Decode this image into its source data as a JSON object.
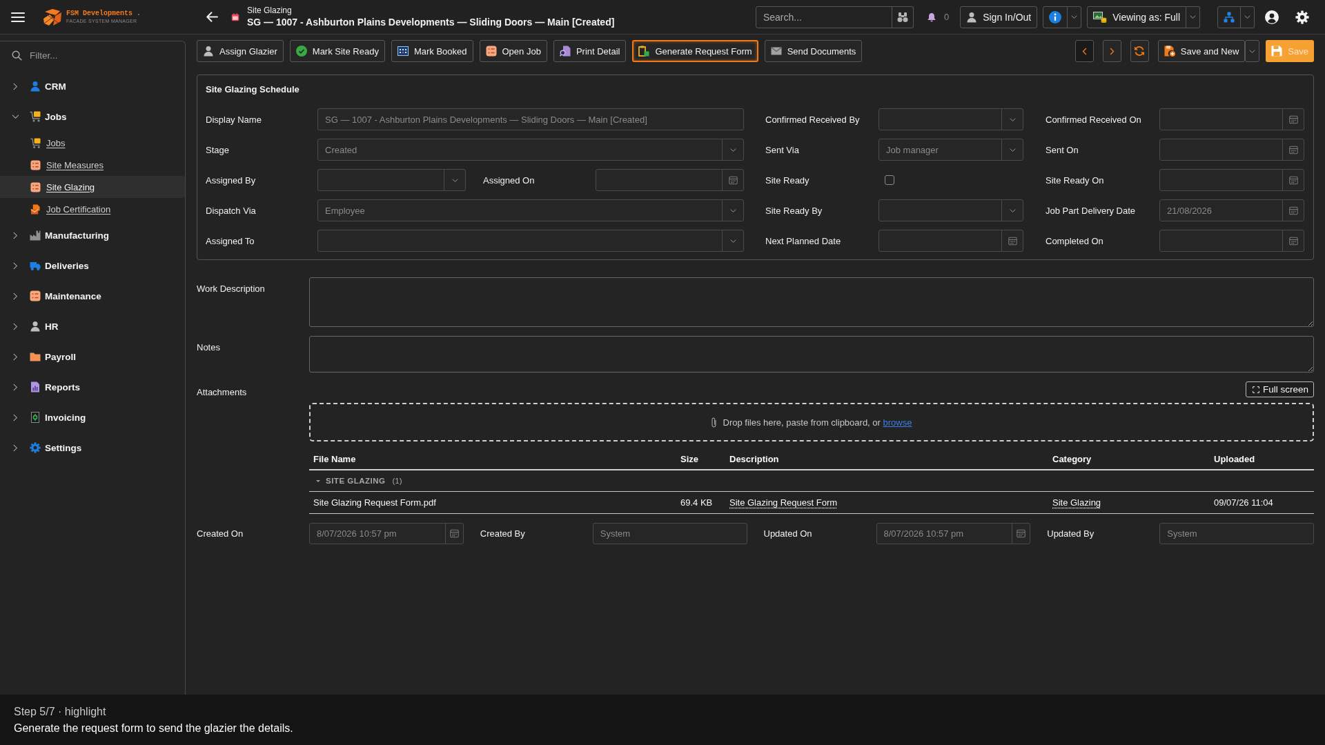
{
  "topbar": {
    "logo": {
      "name": "FSM Developments .",
      "tagline": "FACADE SYSTEM MANAGER"
    },
    "breadcrumb": "Site Glazing",
    "title": "SG — 1007 - Ashburton Plains Developments — Sliding Doors — Main [Created]",
    "search": {
      "placeholder": "Search..."
    },
    "notification_count": "0",
    "sign_button": "Sign In/Out",
    "viewing_button": "Viewing as: Full"
  },
  "sidebar": {
    "filter": {
      "placeholder": "Filter..."
    },
    "items": [
      {
        "label": "CRM",
        "expanded": false
      },
      {
        "label": "Jobs",
        "expanded": true,
        "children": [
          {
            "label": "Jobs",
            "selected": false
          },
          {
            "label": "Site Measures",
            "selected": false
          },
          {
            "label": "Site Glazing",
            "selected": true
          },
          {
            "label": "Job Certification",
            "selected": false
          }
        ]
      },
      {
        "label": "Manufacturing",
        "expanded": false
      },
      {
        "label": "Deliveries",
        "expanded": false
      },
      {
        "label": "Maintenance",
        "expanded": false
      },
      {
        "label": "HR",
        "expanded": false
      },
      {
        "label": "Payroll",
        "expanded": false
      },
      {
        "label": "Reports",
        "expanded": false
      },
      {
        "label": "Invoicing",
        "expanded": false
      },
      {
        "label": "Settings",
        "expanded": false
      }
    ]
  },
  "toolbar": {
    "buttons": [
      {
        "label": "Assign Glazier",
        "highlighted": false
      },
      {
        "label": "Mark Site Ready",
        "highlighted": false
      },
      {
        "label": "Mark Booked",
        "highlighted": false
      },
      {
        "label": "Open Job",
        "highlighted": false
      },
      {
        "label": "Print Detail",
        "highlighted": false
      },
      {
        "label": "Generate Request Form",
        "highlighted": true
      },
      {
        "label": "Send Documents",
        "highlighted": false
      }
    ],
    "save_buttons": [
      {
        "label": "Save and New",
        "kind": "split"
      },
      {
        "label": "Save",
        "kind": "primary"
      }
    ]
  },
  "schedule": {
    "title": "Site Glazing Schedule",
    "rows": [
      {
        "fields": [
          {
            "label": "Display Name",
            "kind": "text",
            "value": "SG — 1007 - Ashburton Plains Developments — Sliding Doors — Main [Created]"
          },
          {
            "label": "Confirmed Received By",
            "kind": "select"
          },
          {
            "label": "Confirmed Received On",
            "kind": "date"
          }
        ]
      },
      {
        "fields": [
          {
            "label": "Stage",
            "kind": "select",
            "value": "Created"
          },
          {
            "label": "Sent Via",
            "kind": "select",
            "value": "Job manager"
          },
          {
            "label": "Sent On",
            "kind": "date"
          }
        ]
      },
      {
        "fields": [
          {
            "label": "Assigned By",
            "kind": "select"
          },
          {
            "label": "Assigned On",
            "kind": "date"
          },
          {
            "label": "Site Ready",
            "kind": "checkbox",
            "checked": false
          },
          {
            "label": "Site Ready On",
            "kind": "date"
          }
        ]
      },
      {
        "fields": [
          {
            "label": "Dispatch Via",
            "kind": "select",
            "value": "Employee"
          },
          {
            "label": "Site Ready By",
            "kind": "select"
          },
          {
            "label": "Job Part Delivery Date",
            "kind": "date",
            "value": "21/08/2026"
          }
        ]
      },
      {
        "fields": [
          {
            "label": "Assigned To",
            "kind": "select"
          },
          {
            "label": "Next Planned Date",
            "kind": "date"
          },
          {
            "label": "Completed On",
            "kind": "date"
          }
        ]
      }
    ]
  },
  "details": [
    {
      "label": "Work Description",
      "kind": "textarea"
    },
    {
      "label": "Notes",
      "kind": "textarea"
    }
  ],
  "attachments": {
    "label": "Attachments",
    "full_screen_button": "Full screen",
    "dropzone": {
      "text": "Drop files here, paste from clipboard, or",
      "link": "browse"
    },
    "table": {
      "columns": [
        "File Name",
        "Size",
        "Description",
        "Category",
        "Uploaded"
      ],
      "groups": [
        {
          "name": "SITE GLAZING",
          "count": "(1)",
          "expanded": true,
          "rows": [
            [
              "Site Glazing Request Form.pdf",
              "69.4 KB",
              "Site Glazing Request Form",
              "Site Glazing",
              "09/07/26 11:04"
            ]
          ]
        }
      ]
    }
  },
  "audit": [
    {
      "label": "Created On",
      "kind": "date",
      "value": "8/07/2026 10:57 pm"
    },
    {
      "label": "Created By",
      "kind": "text",
      "value": "System"
    },
    {
      "label": "Updated On",
      "kind": "date",
      "value": "8/07/2026 10:57 pm"
    },
    {
      "label": "Updated By",
      "kind": "text",
      "value": "System"
    }
  ],
  "tutorial": {
    "step": "Step 5/7 · highlight",
    "message": "Generate the request form to send the glazier the details."
  }
}
